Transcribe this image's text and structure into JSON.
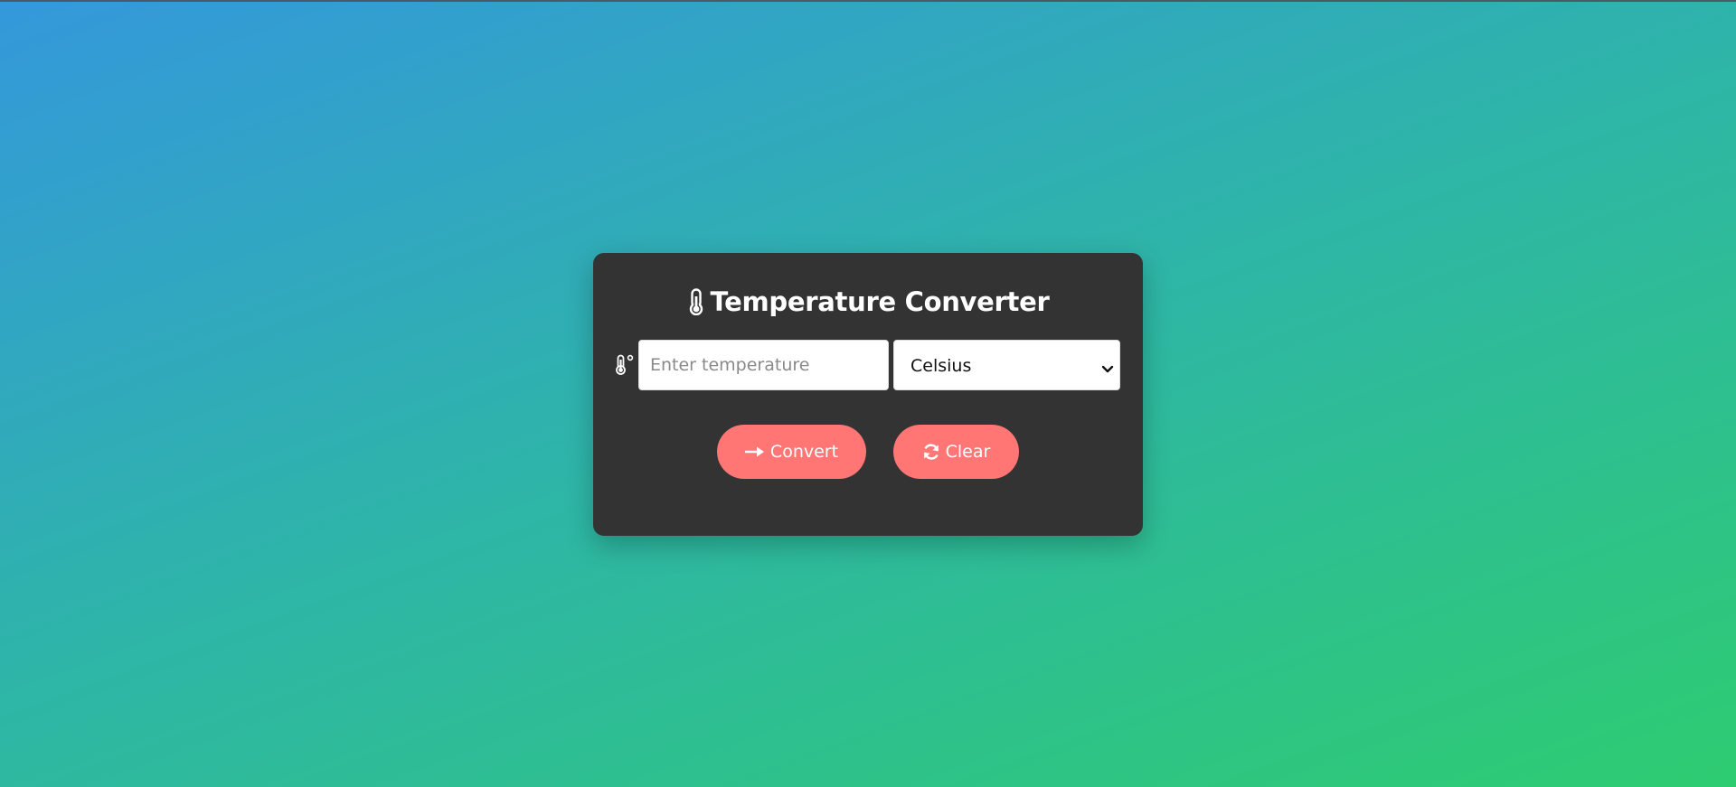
{
  "app": {
    "title": "Temperature Converter",
    "title_icon": "thermometer-icon"
  },
  "form": {
    "temperature_input": {
      "placeholder": "Enter temperature",
      "value": ""
    },
    "input_icon": "thermometer-degree-icon",
    "unit_select": {
      "selected": "Celsius"
    }
  },
  "actions": {
    "convert_label": "Convert",
    "convert_icon": "arrow-right-icon",
    "clear_label": "Clear",
    "clear_icon": "refresh-icon"
  },
  "colors": {
    "background_start": "#3498db",
    "background_end": "#2ecc71",
    "card": "#333333",
    "button": "#ff7675",
    "text": "#ffffff"
  }
}
